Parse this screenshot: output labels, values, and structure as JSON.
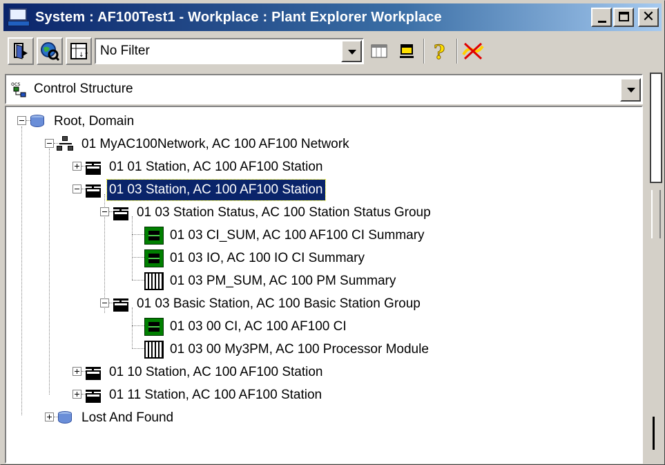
{
  "window": {
    "title": "System : AF100Test1 - Workplace : Plant Explorer Workplace",
    "buttons": {
      "minimize": "_",
      "maximize": "□",
      "close": "✕"
    }
  },
  "toolbar": {
    "filter_value": "No Filter",
    "icons": [
      "exit-door-icon",
      "find-globe-icon",
      "sort-icon",
      "filter-dropdown",
      "columns-icon",
      "yellow-window-icon",
      "help-question-icon",
      "disconnect-icon"
    ]
  },
  "structure": {
    "value": "Control Structure",
    "icon": "ocs-structure-icon"
  },
  "tree": {
    "nodes": [
      {
        "label": "Root, Domain",
        "icon": "database-icon",
        "level": 0,
        "expanded": true
      },
      {
        "label": "01 MyAC100Network, AC 100 AF100 Network",
        "icon": "network-icon",
        "level": 1,
        "expanded": true
      },
      {
        "label": "01 01 Station, AC 100 AF100 Station",
        "icon": "station-icon",
        "level": 2,
        "expanded": false
      },
      {
        "label": "01 03 Station, AC 100 AF100 Station",
        "icon": "station-icon",
        "level": 2,
        "expanded": true,
        "selected": true
      },
      {
        "label": "01 03   Station Status, AC 100 Station Status Group",
        "icon": "station-icon",
        "level": 3,
        "expanded": true
      },
      {
        "label": "01 03 CI_SUM, AC 100 AF100 CI Summary",
        "icon": "ci-module-icon",
        "level": 4
      },
      {
        "label": "01 03 IO, AC 100 IO CI Summary",
        "icon": "ci-module-icon",
        "level": 4
      },
      {
        "label": "01 03 PM_SUM, AC 100 PM Summary",
        "icon": "pm-module-icon",
        "level": 4
      },
      {
        "label": "01 03  Basic Station, AC 100 Basic Station Group",
        "icon": "station-icon",
        "level": 3,
        "expanded": true
      },
      {
        "label": "01 03 00 CI, AC 100 AF100 CI",
        "icon": "ci-module-icon",
        "level": 4
      },
      {
        "label": "01 03 00 My3PM, AC 100 Processor Module",
        "icon": "pm-module-icon",
        "level": 4
      },
      {
        "label": "01 10 Station, AC 100 AF100 Station",
        "icon": "station-icon",
        "level": 2,
        "expanded": false
      },
      {
        "label": "01 11 Station, AC 100 AF100 Station",
        "icon": "station-icon",
        "level": 2,
        "expanded": false
      },
      {
        "label": "Lost And Found",
        "icon": "database-icon",
        "level": 1,
        "expanded": false
      }
    ]
  }
}
